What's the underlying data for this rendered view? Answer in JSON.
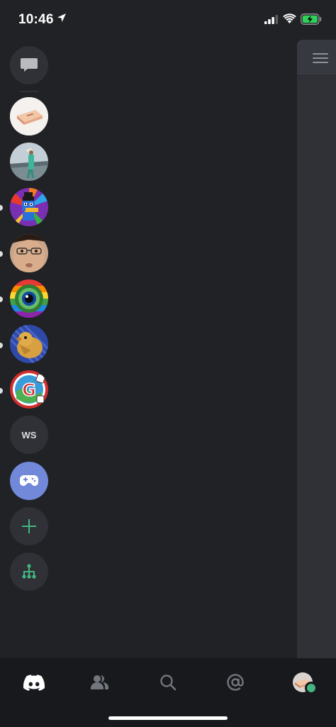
{
  "status_bar": {
    "time": "10:46",
    "icons": [
      "location-arrow-icon",
      "cellular-signal-icon",
      "wifi-icon",
      "battery-charging-icon"
    ],
    "battery_color": "#30d158"
  },
  "guild_rail": {
    "direct_messages": {
      "icon": "chat-bubble-icon"
    },
    "servers": [
      {
        "name": "server-1",
        "icon": "tray-image",
        "unread": false
      },
      {
        "name": "server-2",
        "icon": "person-photo",
        "unread": false
      },
      {
        "name": "server-3",
        "icon": "pixel-duck-image",
        "unread": true
      },
      {
        "name": "server-4",
        "icon": "face-photo",
        "unread": true
      },
      {
        "name": "server-5",
        "icon": "rainbow-eye-image",
        "unread": true
      },
      {
        "name": "server-6",
        "icon": "pixel-chick-image",
        "unread": true
      },
      {
        "name": "server-7",
        "icon": "g-logo-image",
        "unread": true
      },
      {
        "name": "ws",
        "initials": "WS",
        "unread": false
      },
      {
        "name": "gaming",
        "icon": "gamepad-icon",
        "unread": false
      }
    ],
    "add_server": {
      "icon": "plus-icon"
    },
    "explore": {
      "icon": "hub-tree-icon"
    }
  },
  "right_panel": {
    "icon": "hamburger-icon"
  },
  "bottom_nav": {
    "tabs": [
      {
        "name": "home",
        "icon": "discord-logo-icon",
        "active": true
      },
      {
        "name": "friends",
        "icon": "friends-icon",
        "active": false
      },
      {
        "name": "search",
        "icon": "search-icon",
        "active": false
      },
      {
        "name": "mentions",
        "icon": "at-sign-icon",
        "active": false
      },
      {
        "name": "profile",
        "icon": "avatar",
        "active": false
      }
    ]
  },
  "colors": {
    "background": "#202225",
    "rail_button": "#2f3136",
    "blurple": "#7289da",
    "green": "#43b581",
    "nav_background": "#18191c"
  }
}
